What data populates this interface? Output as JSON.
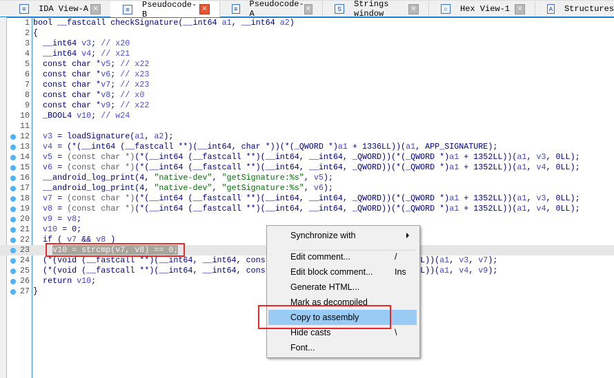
{
  "tabs": [
    {
      "label": "IDA View-A",
      "icon": "disassembly-view-icon",
      "active": false,
      "closable": true
    },
    {
      "label": "Pseudocode-B",
      "icon": "pseudocode-icon",
      "active": true,
      "closable": true
    },
    {
      "label": "Pseudocode-A",
      "icon": "pseudocode-icon",
      "active": false,
      "closable": true
    },
    {
      "label": "Strings window",
      "icon": "strings-icon",
      "active": false,
      "closable": true
    },
    {
      "label": "Hex View-1",
      "icon": "hex-view-icon",
      "active": false,
      "closable": true
    },
    {
      "label": "Structures",
      "icon": "structures-icon",
      "active": false,
      "closable": false
    }
  ],
  "code": {
    "current_line": 23,
    "selected_text": "v10 = strcmp(v7, v8) == 0;",
    "lines": [
      {
        "n": "1",
        "dot": false,
        "text": "bool __fastcall checkSignature(__int64 a1, __int64 a2)"
      },
      {
        "n": "2",
        "dot": false,
        "text": "{"
      },
      {
        "n": "3",
        "dot": false,
        "text": "  __int64 v3; // x20"
      },
      {
        "n": "4",
        "dot": false,
        "text": "  __int64 v4; // x21"
      },
      {
        "n": "5",
        "dot": false,
        "text": "  const char *v5; // x22"
      },
      {
        "n": "6",
        "dot": false,
        "text": "  const char *v6; // x23"
      },
      {
        "n": "7",
        "dot": false,
        "text": "  const char *v7; // x23"
      },
      {
        "n": "8",
        "dot": false,
        "text": "  const char *v8; // x0"
      },
      {
        "n": "9",
        "dot": false,
        "text": "  const char *v9; // x22"
      },
      {
        "n": "10",
        "dot": false,
        "text": "  _BOOL4 v10; // w24"
      },
      {
        "n": "11",
        "dot": false,
        "text": ""
      },
      {
        "n": "12",
        "dot": true,
        "text": "  v3 = loadSignature(a1, a2);"
      },
      {
        "n": "13",
        "dot": true,
        "text": "  v4 = (*(__int64 (__fastcall **)(__int64, char *))(*(_QWORD *)a1 + 1336LL))(a1, APP_SIGNATURE);"
      },
      {
        "n": "14",
        "dot": true,
        "text": "  v5 = (const char *)(*(__int64 (__fastcall **)(__int64, __int64, _QWORD))(*(_QWORD *)a1 + 1352LL))(a1, v3, 0LL);"
      },
      {
        "n": "15",
        "dot": true,
        "text": "  v6 = (const char *)(*(__int64 (__fastcall **)(__int64, __int64, _QWORD))(*(_QWORD *)a1 + 1352LL))(a1, v4, 0LL);"
      },
      {
        "n": "16",
        "dot": true,
        "text": "  __android_log_print(4, \"native-dev\", \"getSignature:%s\", v5);"
      },
      {
        "n": "17",
        "dot": true,
        "text": "  __android_log_print(4, \"native-dev\", \"getSignature:%s\", v6);"
      },
      {
        "n": "18",
        "dot": true,
        "text": "  v7 = (const char *)(*(__int64 (__fastcall **)(__int64, __int64, _QWORD))(*(_QWORD *)a1 + 1352LL))(a1, v3, 0LL);"
      },
      {
        "n": "19",
        "dot": true,
        "text": "  v8 = (const char *)(*(__int64 (__fastcall **)(__int64, __int64, _QWORD))(*(_QWORD *)a1 + 1352LL))(a1, v4, 0LL);"
      },
      {
        "n": "20",
        "dot": true,
        "text": "  v9 = v8;"
      },
      {
        "n": "21",
        "dot": true,
        "text": "  v10 = 0;"
      },
      {
        "n": "22",
        "dot": true,
        "text": "  if ( v7 && v8 )"
      },
      {
        "n": "23",
        "dot": true,
        "text": "    v10 = strcmp(v7, v8) == 0;"
      },
      {
        "n": "24",
        "dot": true,
        "text": "  (*(void (__fastcall **)(__int64, __int64, const char *))(*(_QWORD *)a1 + 1360LL))(a1, v3, v7);"
      },
      {
        "n": "25",
        "dot": true,
        "text": "  (*(void (__fastcall **)(__int64, __int64, const char *))(*(_QWORD *)a1 + 1360LL))(a1, v4, v9);"
      },
      {
        "n": "26",
        "dot": true,
        "text": "  return v10;"
      },
      {
        "n": "27",
        "dot": true,
        "text": "}"
      }
    ]
  },
  "context_menu": {
    "items": [
      {
        "label": "Synchronize with",
        "shortcut": "",
        "submenu": true,
        "mnemonic": "S"
      },
      {
        "separator": true
      },
      {
        "label": "Edit comment...",
        "shortcut": "/"
      },
      {
        "label": "Edit block comment...",
        "shortcut": "Ins"
      },
      {
        "label": "Generate HTML...",
        "shortcut": ""
      },
      {
        "label": "Mark as decompiled",
        "shortcut": ""
      },
      {
        "label": "Copy to assembly",
        "shortcut": "",
        "highlighted": true
      },
      {
        "label": "Hide casts",
        "shortcut": "\\"
      },
      {
        "label": "Font...",
        "shortcut": "",
        "mnemonic": "F"
      }
    ]
  },
  "colors": {
    "accent": "#1e7fd0",
    "highlight": "#99cbf4",
    "annotation": "#ec2525",
    "breakpoint_dot": "#4fb3f5"
  }
}
